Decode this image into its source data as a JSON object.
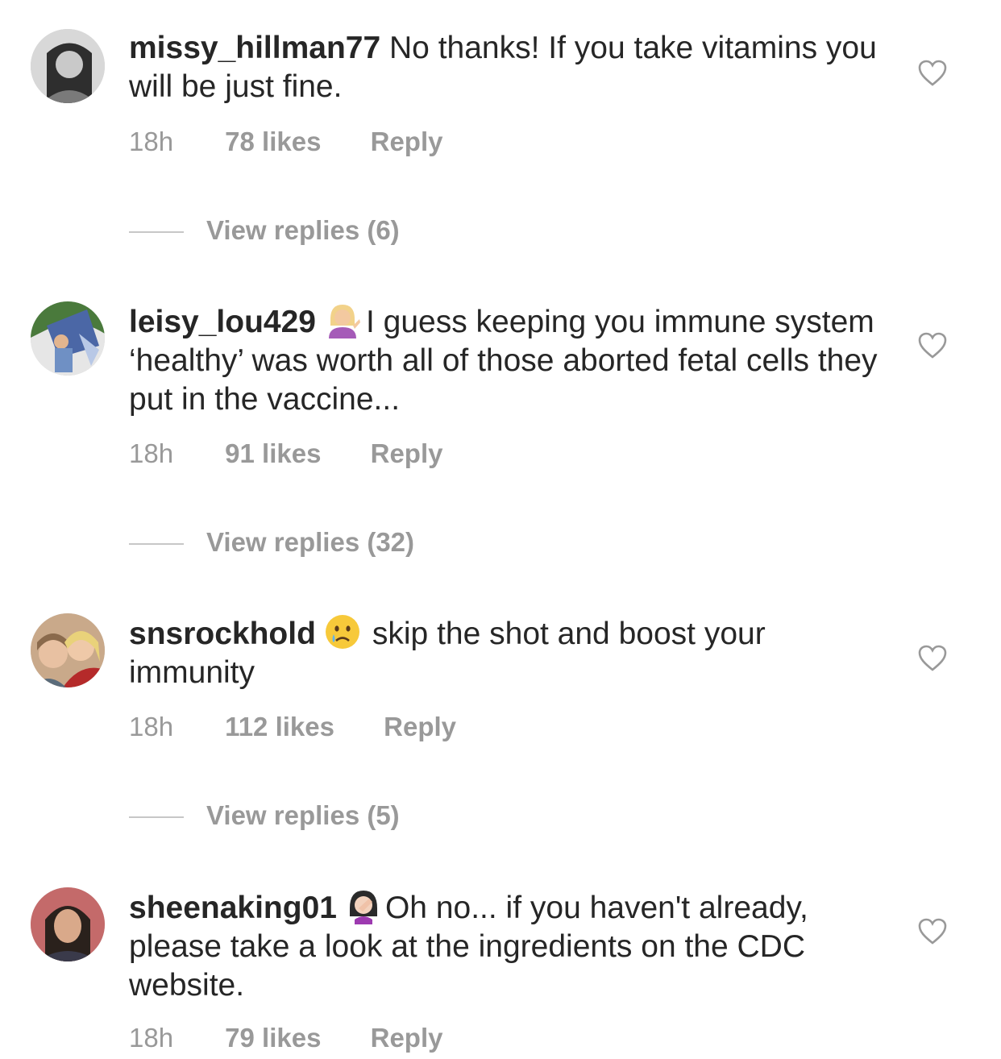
{
  "comments": [
    {
      "username": "missy_hillman77",
      "text": "No thanks! If you take vitamins you will be just fine.",
      "time": "18h",
      "likes": "78 likes",
      "reply": "Reply",
      "view_replies": "View replies (6)"
    },
    {
      "username": "leisy_lou429",
      "emoji": "person-tipping-hand-emoji",
      "text": "I guess keeping you immune system ‘healthy’ was worth all of those aborted fetal cells they put in the vaccine...",
      "time": "18h",
      "likes": "91 likes",
      "reply": "Reply",
      "view_replies": "View replies (32)"
    },
    {
      "username": "snsrockhold",
      "emoji": "crying-face-emoji",
      "text": "skip the shot and boost your immunity",
      "time": "18h",
      "likes": "112 likes",
      "reply": "Reply",
      "view_replies": "View replies (5)"
    },
    {
      "username": "sheenaking01",
      "emoji": "person-facepalming-emoji",
      "text": "Oh no... if you haven't already, please take a look at the ingredients on the CDC website.",
      "time": "18h",
      "likes": "79 likes",
      "reply": "Reply"
    }
  ],
  "colors": {
    "text": "#262626",
    "secondary": "#999999",
    "divider": "#c7c7c7"
  }
}
